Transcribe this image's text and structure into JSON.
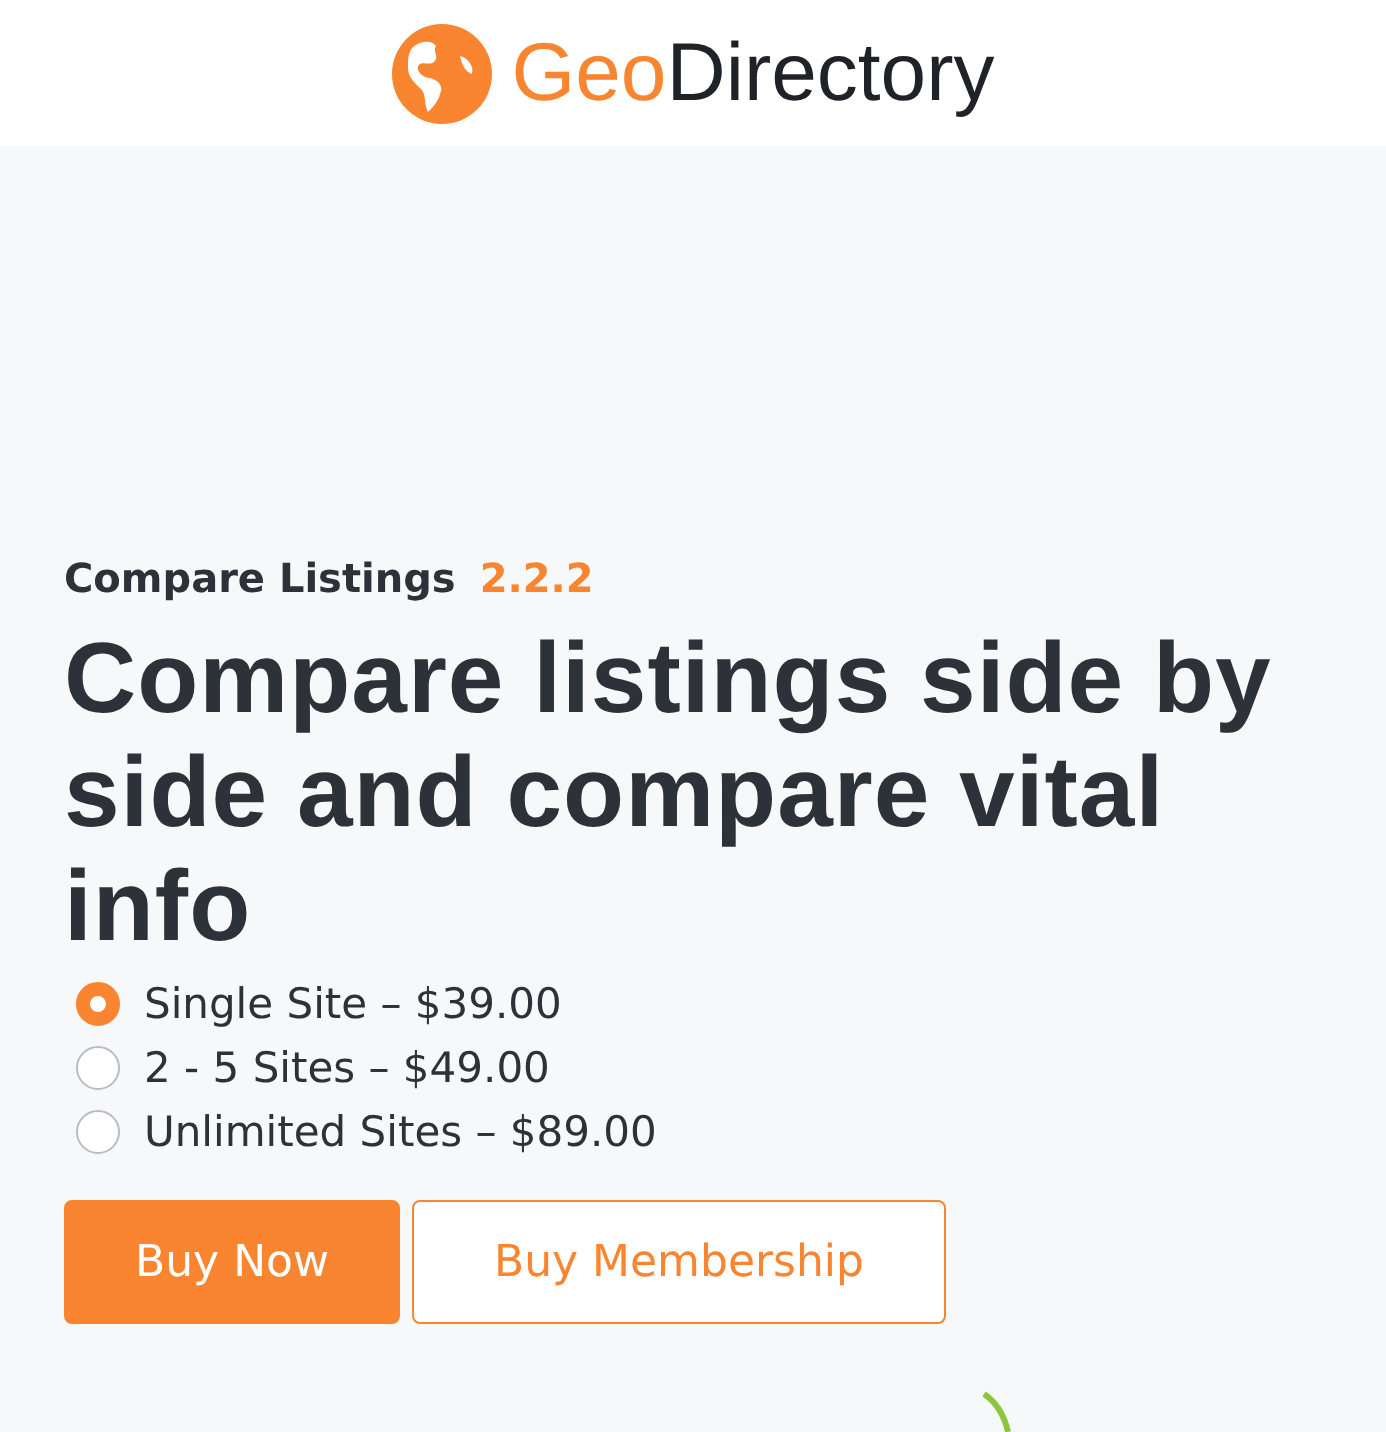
{
  "header": {
    "logo": {
      "prefix": "Geo",
      "name": "Directory"
    }
  },
  "product": {
    "name": "Compare Listings",
    "version": "2.2.2",
    "headline": "Compare listings side by side and compare vital info"
  },
  "plans": [
    {
      "label": "Single Site – $39.00",
      "selected": true
    },
    {
      "label": "2 - 5 Sites – $49.00",
      "selected": false
    },
    {
      "label": "Unlimited Sites – $89.00",
      "selected": false
    }
  ],
  "buttons": [
    {
      "label": "Buy Now",
      "kind": "primary"
    },
    {
      "label": "Buy Membership",
      "kind": "outline"
    }
  ]
}
